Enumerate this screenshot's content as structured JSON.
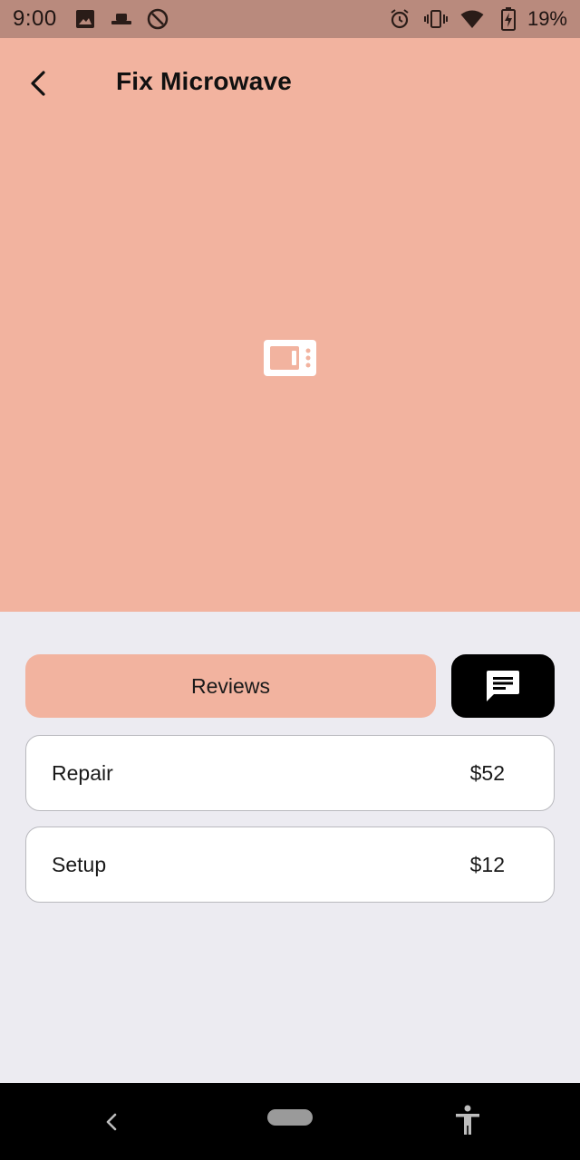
{
  "status_bar": {
    "time": "9:00",
    "battery": "19%",
    "icons_left": [
      "image-icon",
      "hat-icon",
      "do-not-disturb-icon"
    ],
    "icons_right": [
      "alarm-icon",
      "vibrate-icon",
      "wifi-icon",
      "battery-charging-icon"
    ]
  },
  "header": {
    "title": "Fix Microwave",
    "back_icon": "back-arrow-icon"
  },
  "hero": {
    "background_color": "#F2B39F",
    "icon": "microwave-icon"
  },
  "actions": {
    "reviews_label": "Reviews",
    "chat_icon": "chat-icon"
  },
  "services": [
    {
      "name": "Repair",
      "price": "$52"
    },
    {
      "name": "Setup",
      "price": "$12"
    }
  ],
  "nav_bar": {
    "icons": [
      "nav-back-icon",
      "home-pill",
      "accessibility-icon"
    ]
  },
  "colors": {
    "accent": "#F2B39F",
    "status_bar": "#B98A7D",
    "background": "#ECEBF1"
  }
}
